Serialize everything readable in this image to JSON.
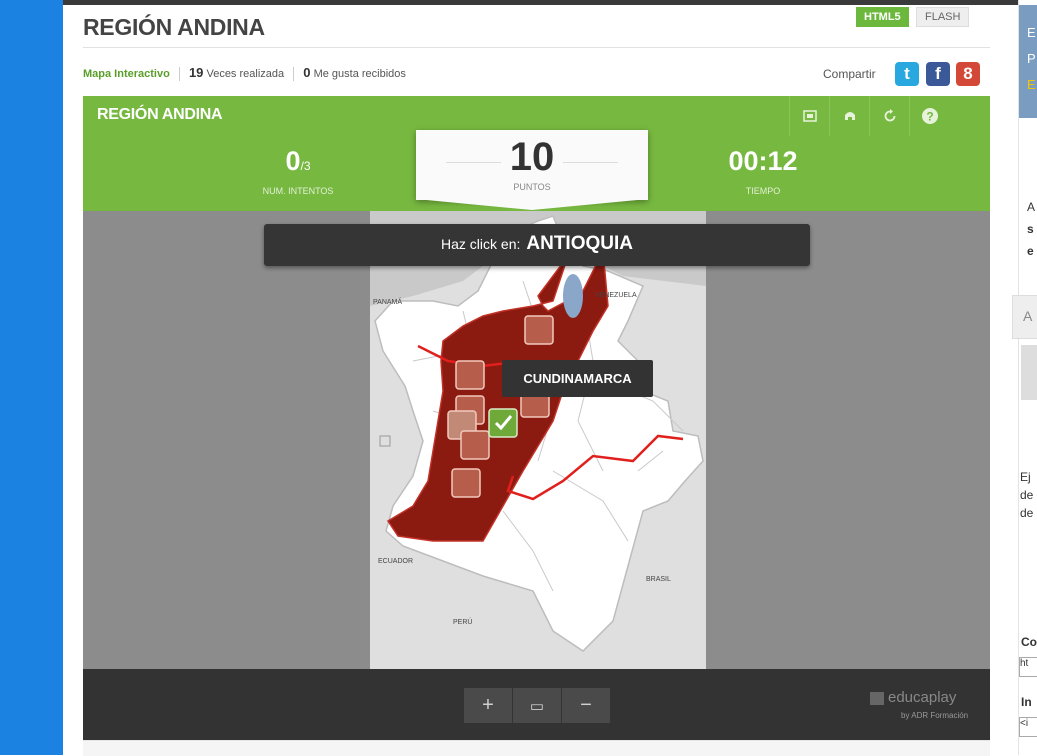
{
  "page": {
    "title": "REGIÓN ANDINA",
    "modes": [
      "HTML5",
      "FLASH"
    ]
  },
  "meta": {
    "type": "Mapa Interactivo",
    "plays": "19",
    "plays_label": "Veces realizada",
    "likes": "0",
    "likes_label": "Me gusta recibidos"
  },
  "share": {
    "label": "Compartir",
    "twitter_glyph": "t",
    "facebook_glyph": "f",
    "google_glyph": "8"
  },
  "game": {
    "title": "REGIÓN ANDINA",
    "header_icons": [
      "fullscreen-icon",
      "print-icon",
      "restart-icon",
      "help-icon"
    ],
    "attempts": "0",
    "attempts_total": "/3",
    "attempts_label": "NUM. INTENTOS",
    "score": "10",
    "score_label": "PUNTOS",
    "time": "00:12",
    "time_label": "TIEMPO",
    "prompt_prefix": "Haz click en:",
    "prompt_target": "ANTIOQUIA",
    "hover_label": "CUNDINAMARCA",
    "map_labels": [
      "PANAMÁ",
      "VENEZUELA",
      "ECUADOR",
      "BRASIL",
      "PERÚ"
    ]
  },
  "toolbar": {
    "zoom_in": "+",
    "zoom_reset": "▭",
    "zoom_out": "−"
  },
  "brand": {
    "name": "educaplay",
    "sub": "by ADR Formación"
  },
  "sidebar": {
    "top_chars": [
      "E",
      "P",
      "E"
    ],
    "mid_chars": [
      "A",
      "s",
      "e"
    ],
    "box_char": "A",
    "text_chars": [
      "Ej",
      "de",
      "de"
    ],
    "label_c": "Co",
    "input_1": "ht",
    "label_in": "In",
    "input_2": "<i"
  },
  "colors": {
    "green": "#77b840",
    "region": "#8b1a10",
    "river": "#e0201c",
    "dark": "#333333",
    "page_blue": "#1b82e2"
  }
}
